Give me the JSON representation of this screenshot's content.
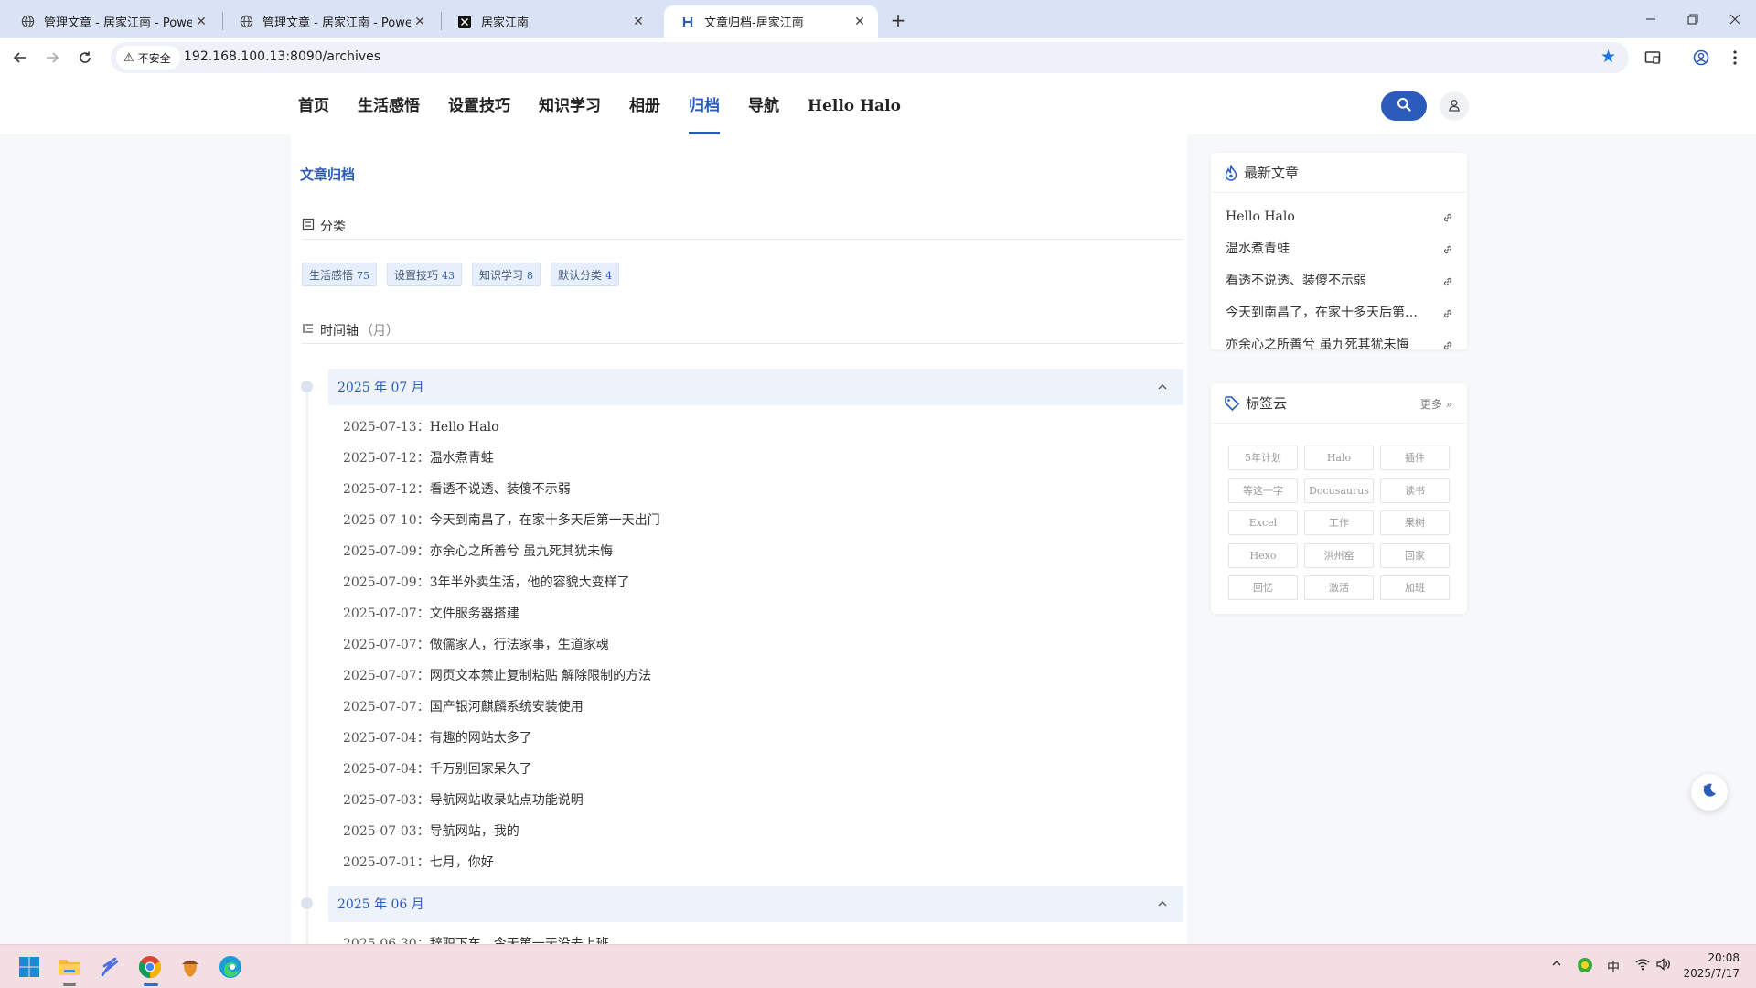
{
  "browser": {
    "tabs": [
      {
        "title": "管理文章 - 居家江南 - Powered",
        "favicon": "globe-icon",
        "active": false
      },
      {
        "title": "管理文章 - 居家江南 - Powered",
        "favicon": "globe-icon",
        "active": false
      },
      {
        "title": "居家江南",
        "favicon": "x-logo-icon",
        "active": false
      },
      {
        "title": "文章归档-居家江南",
        "favicon": "h-logo-icon",
        "active": true
      }
    ],
    "security_label": "不安全",
    "url": "192.168.100.13:8090/archives"
  },
  "site": {
    "nav": [
      {
        "label": "首页",
        "active": false
      },
      {
        "label": "生活感悟",
        "active": false
      },
      {
        "label": "设置技巧",
        "active": false
      },
      {
        "label": "知识学习",
        "active": false
      },
      {
        "label": "相册",
        "active": false
      },
      {
        "label": "归档",
        "active": true
      },
      {
        "label": "导航",
        "active": false
      },
      {
        "label": "Hello Halo",
        "active": false
      }
    ],
    "accent_color": "#2b5cbc"
  },
  "archive": {
    "breadcrumb": "文章归档",
    "categories_heading": "分类",
    "categories": [
      {
        "name": "生活感悟",
        "count": "75"
      },
      {
        "name": "设置技巧",
        "count": "43"
      },
      {
        "name": "知识学习",
        "count": "8"
      },
      {
        "name": "默认分类",
        "count": "4"
      }
    ],
    "timeline_heading": "时间轴",
    "timeline_sub": "（月）",
    "months": [
      {
        "label": "2025 年 07 月",
        "posts": [
          {
            "date": "2025-07-13：",
            "title": "Hello Halo"
          },
          {
            "date": "2025-07-12：",
            "title": "温水煮青蛙"
          },
          {
            "date": "2025-07-12：",
            "title": "看透不说透、装傻不示弱"
          },
          {
            "date": "2025-07-10：",
            "title": "今天到南昌了，在家十多天后第一天出门"
          },
          {
            "date": "2025-07-09：",
            "title": "亦余心之所善兮 虽九死其犹未悔"
          },
          {
            "date": "2025-07-09：",
            "title": "3年半外卖生活，他的容貌大变样了"
          },
          {
            "date": "2025-07-07：",
            "title": "文件服务器搭建"
          },
          {
            "date": "2025-07-07：",
            "title": "做儒家人，行法家事，生道家魂"
          },
          {
            "date": "2025-07-07：",
            "title": "网页文本禁止复制粘贴 解除限制的方法"
          },
          {
            "date": "2025-07-07：",
            "title": "国产银河麒麟系统安装使用"
          },
          {
            "date": "2025-07-04：",
            "title": "有趣的网站太多了"
          },
          {
            "date": "2025-07-04：",
            "title": "千万别回家呆久了"
          },
          {
            "date": "2025-07-03：",
            "title": "导航网站收录站点功能说明"
          },
          {
            "date": "2025-07-03：",
            "title": "导航网站，我的"
          },
          {
            "date": "2025-07-01：",
            "title": "七月，你好"
          }
        ]
      },
      {
        "label": "2025 年 06 月",
        "posts": [
          {
            "date": "2025-06-30：",
            "title": "辞职下车，今天第一天没去上班"
          }
        ]
      }
    ]
  },
  "sidebar": {
    "recent_title": "最新文章",
    "recent_posts": [
      "Hello Halo",
      "温水煮青蛙",
      "看透不说透、装傻不示弱",
      "今天到南昌了，在家十多天后第一天出门",
      "亦余心之所善兮 虽九死其犹未悔"
    ],
    "tags_title": "标签云",
    "tags_more": "更多",
    "tags": [
      "5年计划",
      "Halo",
      "插件",
      "等这一字",
      "Docusaurus",
      "读书",
      "Excel",
      "工作",
      "果树",
      "Hexo",
      "洪州窑",
      "回家",
      "回忆",
      "激活",
      "加班"
    ]
  },
  "taskbar": {
    "ime": "中",
    "time": "20:08",
    "date": "2025/7/17"
  }
}
